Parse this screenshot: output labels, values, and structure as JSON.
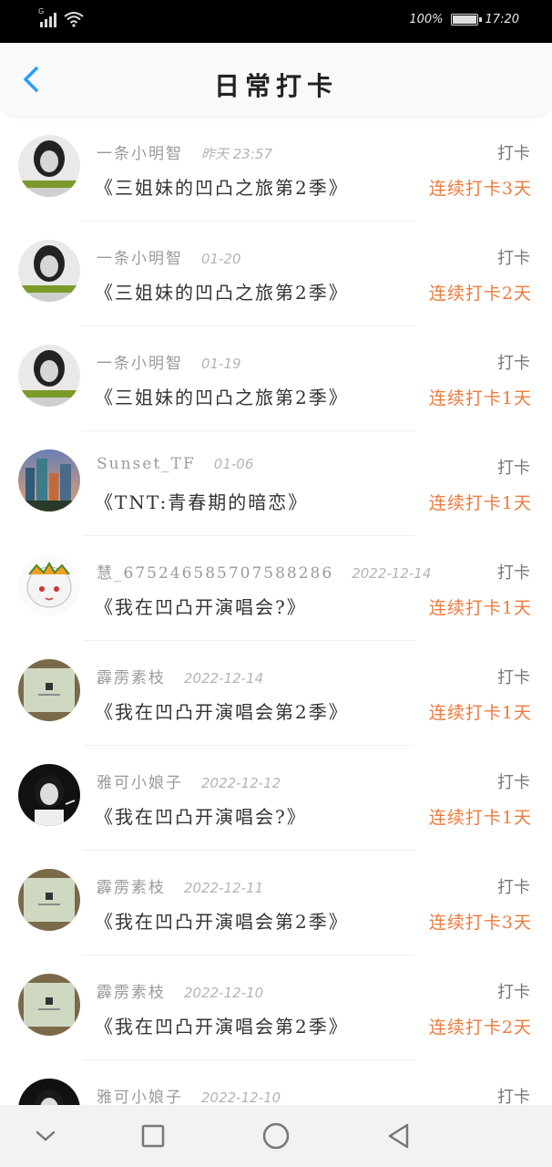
{
  "status": {
    "network": "G",
    "battery": "100%",
    "time": "17:20"
  },
  "header": {
    "title": "日常打卡",
    "back_icon": "chevron-left-icon",
    "accent": "#2a9df4"
  },
  "entries": [
    {
      "user": "一条小明智",
      "date": "昨天 23:57",
      "book": "《三姐妹的凹凸之旅第2季》",
      "action": "打卡",
      "streak": "连续打卡3天",
      "avatar": "avatar-a"
    },
    {
      "user": "一条小明智",
      "date": "01-20",
      "book": "《三姐妹的凹凸之旅第2季》",
      "action": "打卡",
      "streak": "连续打卡2天",
      "avatar": "avatar-a"
    },
    {
      "user": "一条小明智",
      "date": "01-19",
      "book": "《三姐妹的凹凸之旅第2季》",
      "action": "打卡",
      "streak": "连续打卡1天",
      "avatar": "avatar-a"
    },
    {
      "user": "Sunset_TF",
      "date": "01-06",
      "book": "《TNT:青春期的暗恋》",
      "action": "打卡",
      "streak": "连续打卡1天",
      "avatar": "avatar-city"
    },
    {
      "user": "慧_675246585707588286",
      "date": "2022-12-14",
      "book": "《我在凹凸开演唱会?》",
      "action": "打卡",
      "streak": "连续打卡1天",
      "avatar": "avatar-anime"
    },
    {
      "user": "霹雳素枝",
      "date": "2022-12-14",
      "book": "《我在凹凸开演唱会第2季》",
      "action": "打卡",
      "streak": "连续打卡1天",
      "avatar": "avatar-box"
    },
    {
      "user": "雅可小娘子",
      "date": "2022-12-12",
      "book": "《我在凹凸开演唱会?》",
      "action": "打卡",
      "streak": "连续打卡1天",
      "avatar": "avatar-dark"
    },
    {
      "user": "霹雳素枝",
      "date": "2022-12-11",
      "book": "《我在凹凸开演唱会第2季》",
      "action": "打卡",
      "streak": "连续打卡3天",
      "avatar": "avatar-box"
    },
    {
      "user": "霹雳素枝",
      "date": "2022-12-10",
      "book": "《我在凹凸开演唱会第2季》",
      "action": "打卡",
      "streak": "连续打卡2天",
      "avatar": "avatar-box"
    },
    {
      "user": "雅可小娘子",
      "date": "2022-12-10",
      "book": "",
      "action": "打卡",
      "streak": "",
      "avatar": "avatar-dark"
    }
  ],
  "navbar": {
    "icons": [
      "chevron-down-icon",
      "square-icon",
      "circle-icon",
      "triangle-back-icon"
    ]
  }
}
